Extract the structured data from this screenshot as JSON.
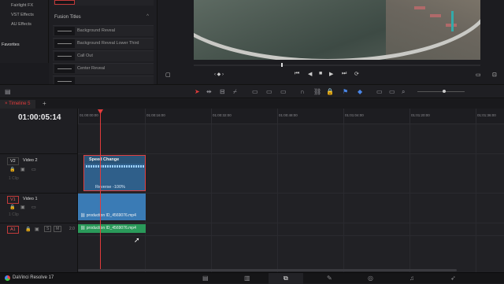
{
  "left_nav": {
    "items": [
      "Fairlight FX",
      "VST Effects",
      "AU Effects"
    ],
    "favorites": "Favorites"
  },
  "effects": {
    "section_title": "Fusion Titles",
    "items": [
      "Background Reveal",
      "Background Reveal Lower Third",
      "Call Out",
      "Center Reveal"
    ]
  },
  "transport": {
    "prev": "⏮",
    "stop": "■",
    "play": "▶",
    "next": "⏭",
    "loop": "⟳"
  },
  "timeline": {
    "tab": "Timeline 5",
    "timecode": "01:00:05:14",
    "ruler": [
      "01:00:00:00",
      "01:00:16:00",
      "01:00:32:00",
      "01:00:48:00",
      "01:01:04:00",
      "01:01:20:00",
      "01:01:36:00"
    ],
    "tracks": {
      "v2": {
        "badge": "V2",
        "name": "Video 2",
        "clips": "1 Clip"
      },
      "v1": {
        "badge": "V1",
        "name": "Video 1",
        "clips": "1 Clip"
      },
      "a1": {
        "badge": "A1",
        "s": "S",
        "m": "M",
        "level": "2.0"
      }
    },
    "clip_v2": {
      "title": "Speed Change",
      "reverse": "Reverse -100%"
    },
    "clip_v1": {
      "name": "production ID_4569076.mp4"
    },
    "clip_a1": {
      "name": "production ID_4569076.mp4"
    }
  },
  "app": {
    "name": "DaVinci Resolve 17"
  },
  "colors": {
    "accent": "#e23b3b",
    "video_clip": "#3a7bb5",
    "audio_clip": "#2a9a5a"
  }
}
